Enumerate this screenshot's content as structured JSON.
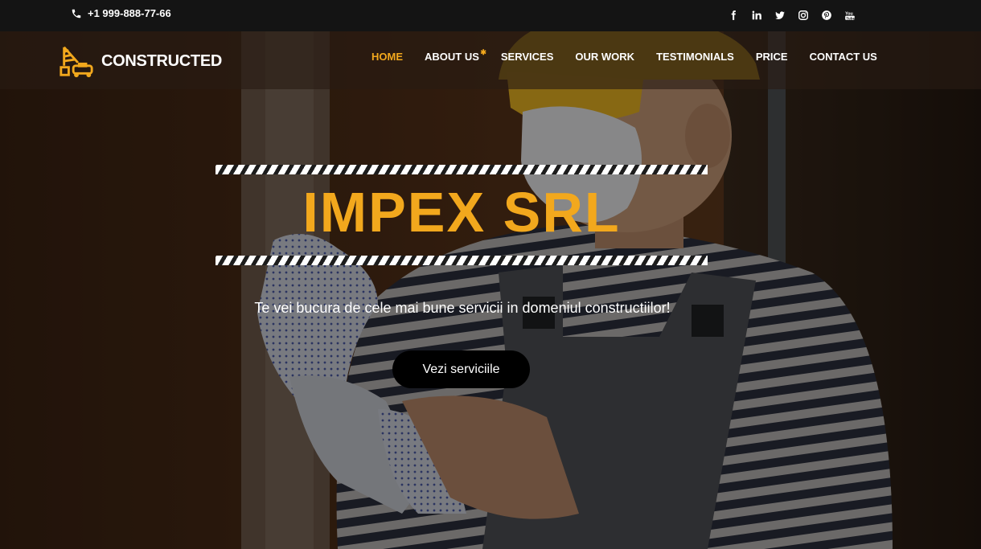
{
  "topbar": {
    "phone": "+1 999-888-77-66",
    "phone_icon": "phone-icon",
    "socials": [
      "facebook-icon",
      "linkedin-icon",
      "twitter-icon",
      "instagram-icon",
      "pinterest-icon",
      "youtube-icon"
    ]
  },
  "navbar": {
    "brand": "CONSTRUCTED",
    "logo_icon": "crane-icon",
    "menu": [
      {
        "label": "HOME",
        "active": true
      },
      {
        "label": "ABOUT US"
      },
      {
        "label": "SERVICES"
      },
      {
        "label": "OUR WORK"
      },
      {
        "label": "TESTIMONIALS"
      },
      {
        "label": "PRICE"
      },
      {
        "label": "CONTACT US"
      }
    ]
  },
  "hero": {
    "title": "IMPEX SRL",
    "tagline": "Te vei bucura de cele mai bune servicii in domeniul constructiilor!",
    "cta": "Vezi serviciile"
  },
  "colors": {
    "accent": "#f2a81d",
    "topbar_bg": "#141414",
    "button_bg": "#000000"
  }
}
